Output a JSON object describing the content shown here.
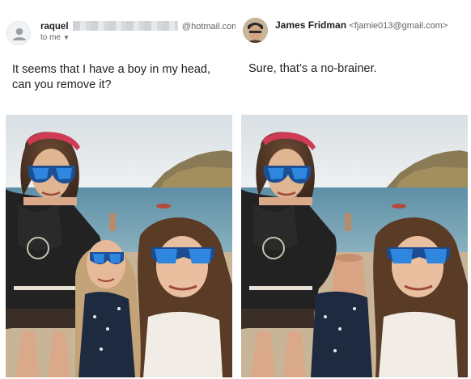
{
  "left_message": {
    "sender_name": "raquel",
    "sender_email": "@hotmail.com>",
    "recipient_label": "to me",
    "body": "It seems that I have a boy in my head, can you remove it?"
  },
  "right_message": {
    "sender_name": "James Fridman",
    "sender_email": "<fjamie013@gmail.com>",
    "body": "Sure, that’s a no-brainer."
  },
  "icons": {
    "default_avatar": "person-silhouette-icon",
    "recipient_dropdown": "caret-down-icon"
  },
  "colors": {
    "text_primary": "#202124",
    "text_secondary": "#5f6368",
    "sky": "#dfe6ea",
    "sea": "#6f9fb4",
    "sand": "#c9b49a",
    "sunglasses_lens": "#2f7ed6"
  }
}
